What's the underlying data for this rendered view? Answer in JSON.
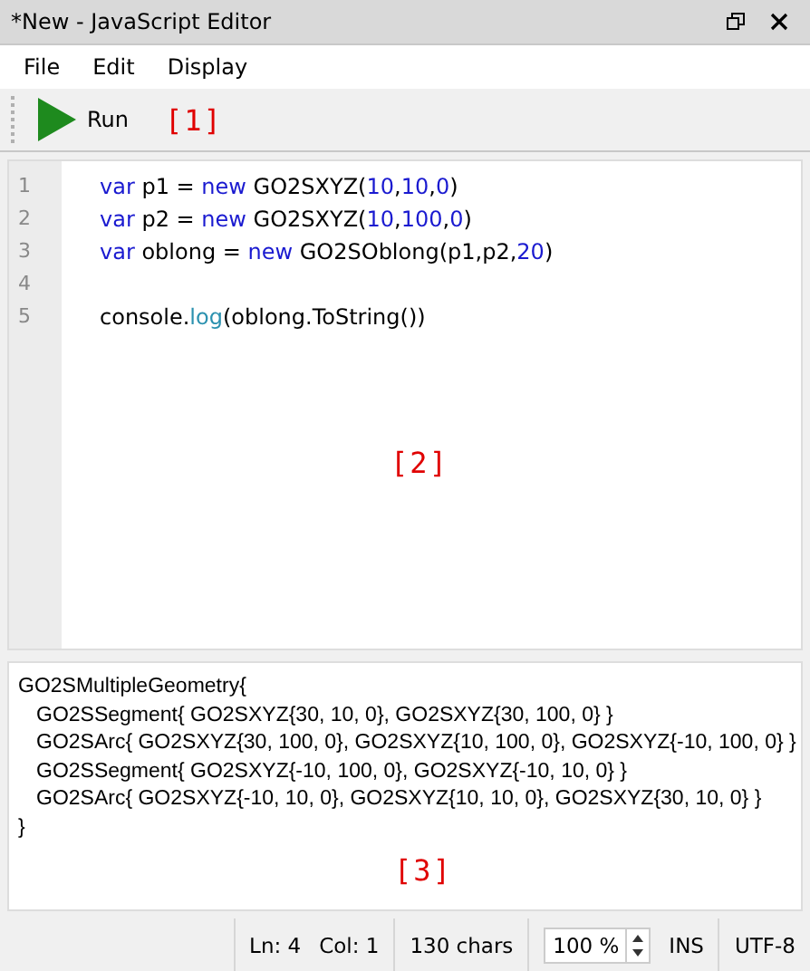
{
  "window": {
    "title": "*New - JavaScript Editor"
  },
  "menu": [
    "File",
    "Edit",
    "Display"
  ],
  "toolbar": {
    "run_label": "Run",
    "callout": "[1]"
  },
  "editor": {
    "callout": "[2]",
    "lines": [
      {
        "number": "1",
        "tokens": [
          {
            "text": "var",
            "kind": "keyword"
          },
          {
            "text": " p1 = ",
            "kind": "plain"
          },
          {
            "text": "new",
            "kind": "keyword"
          },
          {
            "text": " GO2SXYZ(",
            "kind": "plain"
          },
          {
            "text": "10",
            "kind": "number"
          },
          {
            "text": ",",
            "kind": "plain"
          },
          {
            "text": "10",
            "kind": "number"
          },
          {
            "text": ",",
            "kind": "plain"
          },
          {
            "text": "0",
            "kind": "number"
          },
          {
            "text": ")",
            "kind": "plain"
          }
        ]
      },
      {
        "number": "2",
        "tokens": [
          {
            "text": "var",
            "kind": "keyword"
          },
          {
            "text": " p2 = ",
            "kind": "plain"
          },
          {
            "text": "new",
            "kind": "keyword"
          },
          {
            "text": " GO2SXYZ(",
            "kind": "plain"
          },
          {
            "text": "10",
            "kind": "number"
          },
          {
            "text": ",",
            "kind": "plain"
          },
          {
            "text": "100",
            "kind": "number"
          },
          {
            "text": ",",
            "kind": "plain"
          },
          {
            "text": "0",
            "kind": "number"
          },
          {
            "text": ")",
            "kind": "plain"
          }
        ]
      },
      {
        "number": "3",
        "tokens": [
          {
            "text": "var",
            "kind": "keyword"
          },
          {
            "text": " oblong = ",
            "kind": "plain"
          },
          {
            "text": "new",
            "kind": "keyword"
          },
          {
            "text": " GO2SOblong(p1,p2,",
            "kind": "plain"
          },
          {
            "text": "20",
            "kind": "number"
          },
          {
            "text": ")",
            "kind": "plain"
          }
        ]
      },
      {
        "number": "4"
      },
      {
        "number": "5",
        "tokens": [
          {
            "text": "console.",
            "kind": "plain"
          },
          {
            "text": "log",
            "kind": "method"
          },
          {
            "text": "(oblong.ToString())",
            "kind": "plain"
          }
        ]
      }
    ]
  },
  "output": {
    "callout": "[3]",
    "lines": [
      {
        "text": "GO2SMultipleGeometry{",
        "indented": false
      },
      {
        "text": "GO2SSegment{ GO2SXYZ{30, 10, 0}, GO2SXYZ{30, 100, 0} }",
        "indented": true
      },
      {
        "text": "GO2SArc{ GO2SXYZ{30, 100, 0}, GO2SXYZ{10, 100, 0}, GO2SXYZ{-10, 100, 0} }",
        "indented": true
      },
      {
        "text": "GO2SSegment{ GO2SXYZ{-10, 100, 0}, GO2SXYZ{-10, 10, 0} }",
        "indented": true
      },
      {
        "text": "GO2SArc{ GO2SXYZ{-10, 10, 0}, GO2SXYZ{10, 10, 0}, GO2SXYZ{30, 10, 0} }",
        "indented": true
      },
      {
        "text": "}",
        "indented": false
      }
    ]
  },
  "status_bar": {
    "line": "Ln: 4",
    "column": "Col: 1",
    "chars": "130 chars",
    "zoom": "100 %",
    "mode": "INS",
    "encoding": "UTF-8"
  }
}
